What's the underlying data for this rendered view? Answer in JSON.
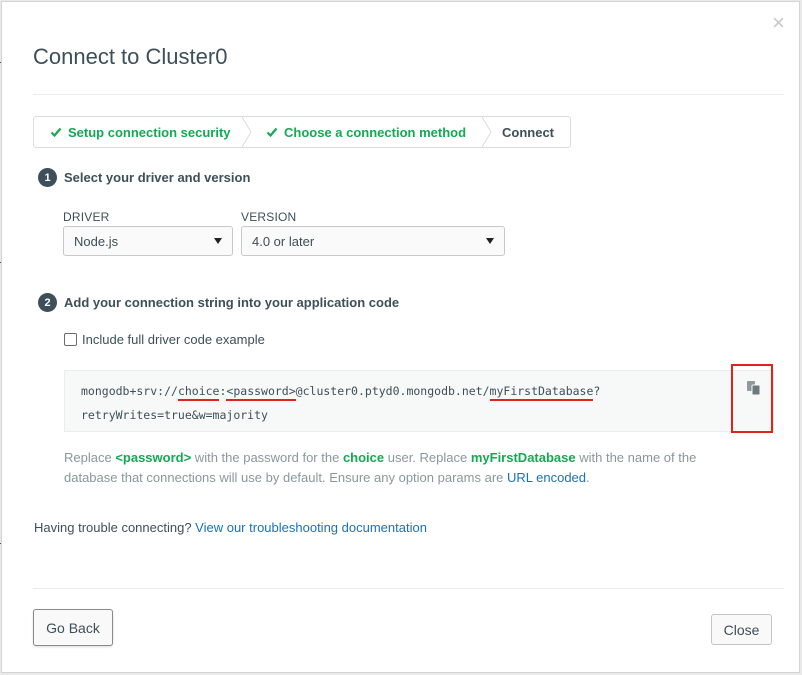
{
  "modal": {
    "title": "Connect to Cluster0",
    "close_glyph": "×"
  },
  "steps": [
    {
      "label": "Setup connection security",
      "done": true
    },
    {
      "label": "Choose a connection method",
      "done": true
    },
    {
      "label": "Connect",
      "done": false
    }
  ],
  "section1": {
    "number": "1",
    "title": "Select your driver and version",
    "driver_label": "DRIVER",
    "driver_value": "Node.js",
    "version_label": "VERSION",
    "version_value": "4.0 or later"
  },
  "section2": {
    "number": "2",
    "title": "Add your connection string into your application code",
    "checkbox_label": "Include full driver code example",
    "checkbox_checked": false,
    "code": {
      "part1": "mongodb+srv://",
      "user": "choice",
      "colon": ":",
      "password": "<password>",
      "part2": "@cluster0.ptyd0.mongodb.net/",
      "db": "myFirstDatabase",
      "part3": "?",
      "line2": "retryWrites=true&w=majority"
    },
    "copy_icon": "copy-icon",
    "help": {
      "t1": "Replace ",
      "password": "<password>",
      "t2": " with the password for the ",
      "user": "choice",
      "t3": " user. Replace ",
      "db": "myFirstDatabase",
      "t4": " with the name of the database that connections will use by default. Ensure any option params are ",
      "link": "URL encoded",
      "t5": "."
    }
  },
  "trouble": {
    "text": "Having trouble connecting? ",
    "link": "View our troubleshooting documentation"
  },
  "footer": {
    "back_label": "Go Back",
    "close_label": "Close"
  },
  "colors": {
    "accent_green": "#13aa52",
    "link_blue": "#1a73b8",
    "highlight_red": "#e2231a",
    "text_dark": "#3d4f58"
  }
}
